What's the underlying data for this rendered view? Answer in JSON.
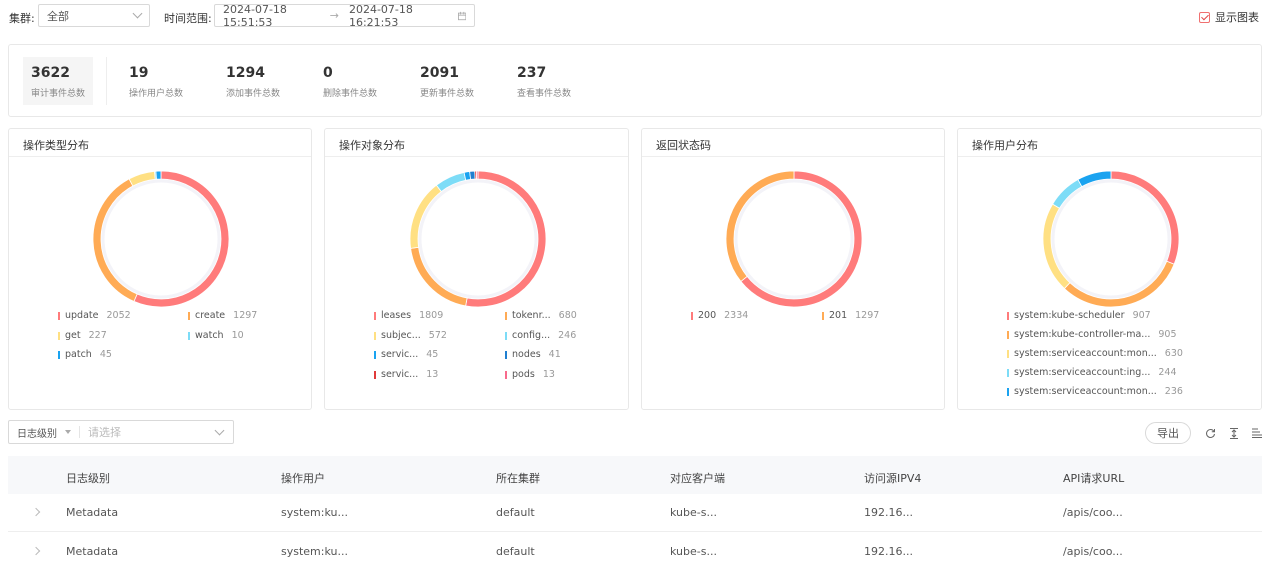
{
  "filter": {
    "cluster_label": "集群:",
    "cluster_value": "全部",
    "time_label": "时间范围:",
    "start_time": "2024-07-18 15:51:53",
    "arrow": "→",
    "end_time": "2024-07-18 16:21:53",
    "show_chart_label": "显示图表",
    "show_chart_checked": true
  },
  "stats": [
    {
      "value": "3622",
      "label": "审计事件总数"
    },
    {
      "value": "19",
      "label": "操作用户总数"
    },
    {
      "value": "1294",
      "label": "添加事件总数"
    },
    {
      "value": "0",
      "label": "删除事件总数"
    },
    {
      "value": "2091",
      "label": "更新事件总数"
    },
    {
      "value": "237",
      "label": "查看事件总数"
    }
  ],
  "colors": {
    "red": "#ff7b7b",
    "orange": "#ffab55",
    "yellow": "#ffe083",
    "cyan": "#7ddcf7",
    "blue": "#1aa3f0",
    "crimson": "#e03a3a",
    "pink": "#f86a8c"
  },
  "panels": [
    {
      "title": "操作类型分布",
      "items": [
        {
          "name": "update",
          "value": "2052",
          "color": "#ff7b7b",
          "v": 2052
        },
        {
          "name": "create",
          "value": "1297",
          "color": "#ffab55",
          "v": 1297
        },
        {
          "name": "get",
          "value": "227",
          "color": "#ffe083",
          "v": 227
        },
        {
          "name": "watch",
          "value": "10",
          "color": "#7ddcf7",
          "v": 10
        },
        {
          "name": "patch",
          "value": "45",
          "color": "#1aa3f0",
          "v": 45
        }
      ]
    },
    {
      "title": "操作对象分布",
      "items": [
        {
          "name": "leases",
          "value": "1809",
          "color": "#ff7b7b",
          "v": 1809
        },
        {
          "name": "tokenr...",
          "value": "680",
          "color": "#ffab55",
          "v": 680
        },
        {
          "name": "subjec...",
          "value": "572",
          "color": "#ffe083",
          "v": 572
        },
        {
          "name": "config...",
          "value": "246",
          "color": "#7ddcf7",
          "v": 246
        },
        {
          "name": "servic...",
          "value": "45",
          "color": "#1aa3f0",
          "v": 45
        },
        {
          "name": "nodes",
          "value": "41",
          "color": "#1f7fd0",
          "v": 41
        },
        {
          "name": "servic...",
          "value": "13",
          "color": "#e03a3a",
          "v": 13
        },
        {
          "name": "pods",
          "value": "13",
          "color": "#f86a8c",
          "v": 13
        }
      ]
    },
    {
      "title": "返回状态码",
      "items": [
        {
          "name": "200",
          "value": "2334",
          "color": "#ff7b7b",
          "v": 2334
        },
        {
          "name": "201",
          "value": "1297",
          "color": "#ffab55",
          "v": 1297
        }
      ]
    },
    {
      "title": "操作用户分布",
      "items": [
        {
          "name": "system:kube-scheduler",
          "value": "907",
          "color": "#ff7b7b",
          "v": 907
        },
        {
          "name": "system:kube-controller-ma...",
          "value": "905",
          "color": "#ffab55",
          "v": 905
        },
        {
          "name": "system:serviceaccount:mon...",
          "value": "630",
          "color": "#ffe083",
          "v": 630
        },
        {
          "name": "system:serviceaccount:ing...",
          "value": "244",
          "color": "#7ddcf7",
          "v": 244
        },
        {
          "name": "system:serviceaccount:mon...",
          "value": "236",
          "color": "#1aa3f0",
          "v": 236
        }
      ]
    }
  ],
  "table_toolbar": {
    "level_label": "日志级别",
    "level_placeholder": "请选择",
    "export_label": "导出"
  },
  "table": {
    "headers": [
      "日志级别",
      "操作用户",
      "所在集群",
      "对应客户端",
      "访问源IPV4",
      "API请求URL"
    ],
    "rows": [
      [
        "Metadata",
        "system:ku...",
        "default",
        "kube-s...",
        "192.16...",
        "/apis/coo..."
      ],
      [
        "Metadata",
        "system:ku...",
        "default",
        "kube-s...",
        "192.16...",
        "/apis/coo..."
      ]
    ]
  }
}
